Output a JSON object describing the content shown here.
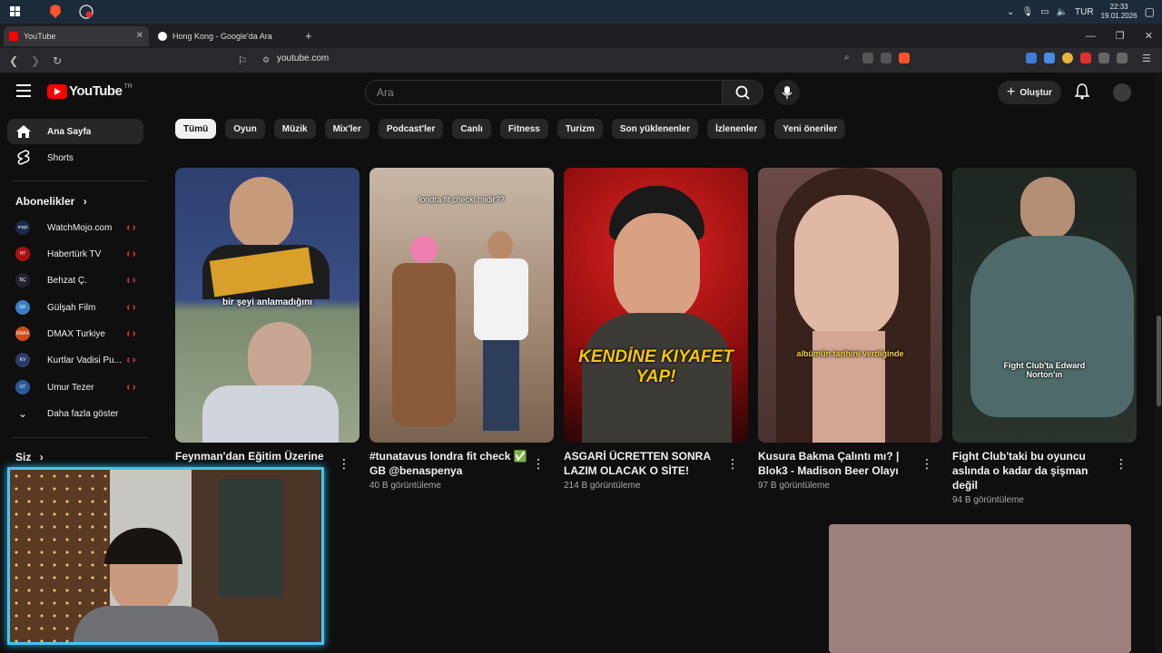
{
  "taskbar": {
    "lang": "TUR",
    "time": "22:33",
    "date": "19.01.2026"
  },
  "tabs": [
    {
      "label": "YouTube",
      "active": true
    },
    {
      "label": "Hong Kong - Google'da Ara",
      "active": false
    }
  ],
  "address": {
    "url": "youtube.com"
  },
  "header": {
    "logo": "YouTube",
    "region": "TR",
    "search_placeholder": "Ara",
    "create_label": "Oluştur"
  },
  "sidebar": {
    "items": [
      {
        "label": "Ana Sayfa",
        "icon": "home-icon"
      },
      {
        "label": "Shorts",
        "icon": "shorts-icon"
      }
    ],
    "subs_heading": "Abonelikler",
    "subscriptions": [
      {
        "label": "WatchMojo.com",
        "color": "#1b2a4a",
        "initials": "mojo"
      },
      {
        "label": "Habertürk TV",
        "color": "#a11",
        "initials": "HT"
      },
      {
        "label": "Behzat Ç.",
        "color": "#223",
        "initials": "BÇ"
      },
      {
        "label": "Gülşah Film",
        "color": "#3a7fc4",
        "initials": "GF"
      },
      {
        "label": "DMAX Turkiye",
        "color": "#d24a1a",
        "initials": "DMAX"
      },
      {
        "label": "Kurtlar Vadisi Pu...",
        "color": "#2b3b6b",
        "initials": "KV"
      },
      {
        "label": "Umur Tezer",
        "color": "#2a5b9a",
        "initials": "UT"
      }
    ],
    "more_label": "Daha fazla göster",
    "you_heading": "Siz"
  },
  "chips": [
    "Tümü",
    "Oyun",
    "Müzik",
    "Mix'ler",
    "Podcast'ler",
    "Canlı",
    "Fitness",
    "Turizm",
    "Son yüklenenler",
    "İzlenenler",
    "Yeni öneriler"
  ],
  "shorts": [
    {
      "title": "Feynman'dan Eğitim Üzerine",
      "views": "",
      "caption": "bir şeyi anlamadığını",
      "bg": "#2d3f6e"
    },
    {
      "title": "#tunatavus londra fit check ✅ GB @benaspenya",
      "views": "40 B görüntüleme",
      "caption": "londra fit checki midir??",
      "bg": "#8a6a52"
    },
    {
      "title": "ASGARİ ÜCRETTEN SONRA LAZIM OLACAK O SİTE!",
      "views": "214 B görüntüleme",
      "caption": "KENDİNE KIYAFET YAP!",
      "bg": "#b01818"
    },
    {
      "title": "Kusura Bakma Çalıntı mı? | Blok3 - Madison Beer Olayı",
      "views": "97 B görüntüleme",
      "caption": "albümün tarihini verdiğinde",
      "bg": "#6a4a45"
    },
    {
      "title": "Fight Club'taki bu oyuncu aslında o kadar da şişman değil",
      "views": "94 B görüntüleme",
      "caption": "Fight Club'ta Edward Norton'ın",
      "bg": "#24302a"
    }
  ]
}
